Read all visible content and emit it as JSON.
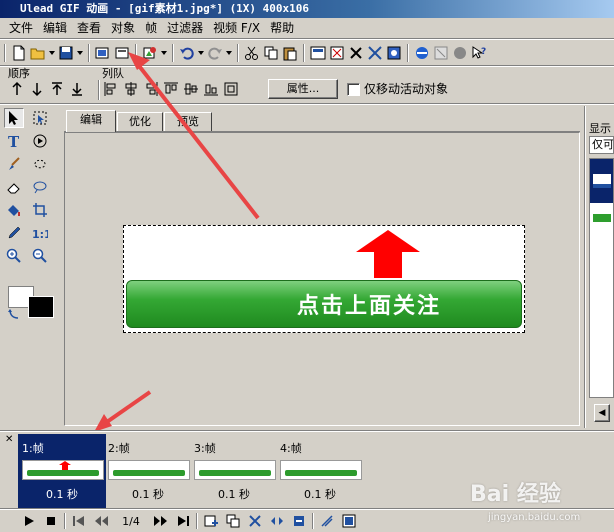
{
  "window": {
    "title": "Ulead GIF 动画 - [gif素材1.jpg*] (1X) 400x106"
  },
  "menu": [
    "文件",
    "编辑",
    "查看",
    "对象",
    "帧",
    "过滤器",
    "视频 F/X",
    "帮助"
  ],
  "toolbar2": {
    "order_label": "顺序",
    "queue_label": "列队",
    "properties_button": "属性...",
    "move_active_only": "仅移动活动对象"
  },
  "tabs": [
    "编辑",
    "优化",
    "预览"
  ],
  "right_panel": {
    "label": "显示",
    "field": "仅可"
  },
  "canvas": {
    "banner_text": "点击上面关注",
    "banner_color": "#2e9e2e",
    "arrow_color": "#ff0000"
  },
  "frames": [
    {
      "label": "1:帧",
      "duration": "0.1 秒",
      "selected": true
    },
    {
      "label": "2:帧",
      "duration": "0.1 秒",
      "selected": false
    },
    {
      "label": "3:帧",
      "duration": "0.1 秒",
      "selected": false
    },
    {
      "label": "4:帧",
      "duration": "0.1 秒",
      "selected": false
    }
  ],
  "frame_thumb_text": "点击上面关注",
  "playback": {
    "frame_counter": "1/4"
  },
  "watermark": {
    "brand": "Bai 经验",
    "url": "jingyan.baidu.com"
  }
}
